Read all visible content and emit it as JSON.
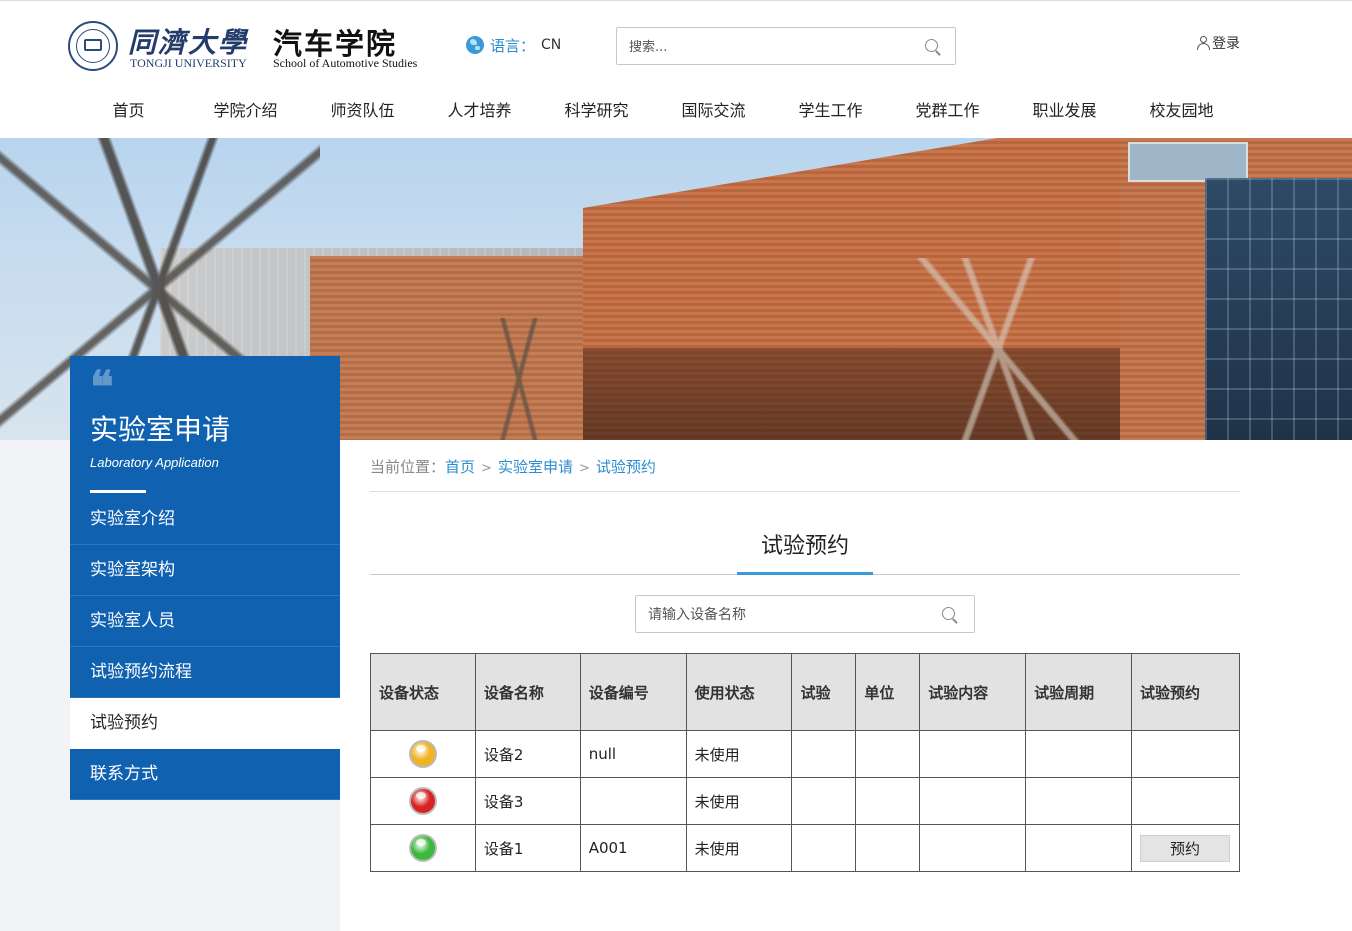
{
  "header": {
    "university_cn": "同濟大學",
    "university_en": "TONGJI UNIVERSITY",
    "school_cn": "汽车学院",
    "school_en": "School of Automotive Studies",
    "language_label": "语言：",
    "language_value": "CN",
    "search_placeholder": "搜索...",
    "login_label": "登录"
  },
  "nav": [
    "首页",
    "学院介绍",
    "师资队伍",
    "人才培养",
    "科学研究",
    "国际交流",
    "学生工作",
    "党群工作",
    "职业发展",
    "校友园地"
  ],
  "sidebar": {
    "quote": "❝",
    "title": "实验室申请",
    "subtitle": "Laboratory Application",
    "items": [
      {
        "label": "实验室介绍",
        "active": false
      },
      {
        "label": "实验室架构",
        "active": false
      },
      {
        "label": "实验室人员",
        "active": false
      },
      {
        "label": "试验预约流程",
        "active": false
      },
      {
        "label": "试验预约",
        "active": true
      },
      {
        "label": "联系方式",
        "active": false
      }
    ]
  },
  "breadcrumb": {
    "prefix": "当前位置：",
    "sep": ">",
    "items": [
      "首页",
      "实验室申请",
      "试验预约"
    ]
  },
  "page_title": "试验预约",
  "device_search_placeholder": "请输入设备名称",
  "table": {
    "headers": [
      "设备状态",
      "设备名称",
      "设备编号",
      "使用状态",
      "试验",
      "单位",
      "试验内容",
      "试验周期",
      "试验预约"
    ],
    "rows": [
      {
        "status_color": "#f0b323",
        "name": "设备2",
        "code": "null",
        "usage": "未使用",
        "test": "",
        "unit": "",
        "content": "",
        "period": "",
        "action": ""
      },
      {
        "status_color": "#d92222",
        "name": "设备3",
        "code": "",
        "usage": "未使用",
        "test": "",
        "unit": "",
        "content": "",
        "period": "",
        "action": ""
      },
      {
        "status_color": "#3cb83c",
        "name": "设备1",
        "code": "A001",
        "usage": "未使用",
        "test": "",
        "unit": "",
        "content": "",
        "period": "",
        "action": "预约"
      }
    ]
  },
  "colors": {
    "brand_blue": "#1062b0",
    "link_blue": "#2b8dd0",
    "accent_underline": "#3a9ad9"
  }
}
